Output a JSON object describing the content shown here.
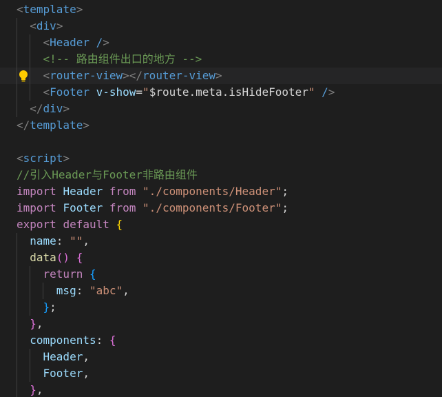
{
  "editor": {
    "lines": [
      [
        {
          "t": "<",
          "c": "punc"
        },
        {
          "t": "template",
          "c": "tag"
        },
        {
          "t": ">",
          "c": "punc"
        }
      ],
      [
        {
          "t": "  "
        },
        {
          "t": "<",
          "c": "punc"
        },
        {
          "t": "div",
          "c": "tag"
        },
        {
          "t": ">",
          "c": "punc"
        }
      ],
      [
        {
          "t": "    "
        },
        {
          "t": "<",
          "c": "punc"
        },
        {
          "t": "Header",
          "c": "tag"
        },
        {
          "t": " /",
          "c": "tag"
        },
        {
          "t": ">",
          "c": "punc"
        }
      ],
      [
        {
          "t": "    "
        },
        {
          "t": "<!-- 路由组件出口的地方 -->",
          "c": "comment"
        }
      ],
      [
        {
          "t": "    "
        },
        {
          "t": "<",
          "c": "punc"
        },
        {
          "t": "router-view",
          "c": "tag"
        },
        {
          "t": "></",
          "c": "punc"
        },
        {
          "t": "router-view",
          "c": "tag"
        },
        {
          "t": ">",
          "c": "punc"
        }
      ],
      [
        {
          "t": "    "
        },
        {
          "t": "<",
          "c": "punc"
        },
        {
          "t": "Footer",
          "c": "tag"
        },
        {
          "t": " "
        },
        {
          "t": "v-show",
          "c": "attr"
        },
        {
          "t": "=",
          "c": "plain"
        },
        {
          "t": "\"",
          "c": "str"
        },
        {
          "t": "$route.meta.isHideFooter",
          "c": "plain"
        },
        {
          "t": "\"",
          "c": "str"
        },
        {
          "t": " "
        },
        {
          "t": "/",
          "c": "tag"
        },
        {
          "t": ">",
          "c": "punc"
        }
      ],
      [
        {
          "t": "  "
        },
        {
          "t": "</",
          "c": "punc"
        },
        {
          "t": "div",
          "c": "tag"
        },
        {
          "t": ">",
          "c": "punc"
        }
      ],
      [
        {
          "t": "</",
          "c": "punc"
        },
        {
          "t": "template",
          "c": "tag"
        },
        {
          "t": ">",
          "c": "punc"
        }
      ],
      [],
      [
        {
          "t": "<",
          "c": "punc"
        },
        {
          "t": "script",
          "c": "tag"
        },
        {
          "t": ">",
          "c": "punc"
        }
      ],
      [
        {
          "t": "//引入Header与Footer非路由组件",
          "c": "comment"
        }
      ],
      [
        {
          "t": "import",
          "c": "kw"
        },
        {
          "t": " "
        },
        {
          "t": "Header",
          "c": "var"
        },
        {
          "t": " "
        },
        {
          "t": "from",
          "c": "kw"
        },
        {
          "t": " "
        },
        {
          "t": "\"./components/Header\"",
          "c": "str"
        },
        {
          "t": ";",
          "c": "plain"
        }
      ],
      [
        {
          "t": "import",
          "c": "kw"
        },
        {
          "t": " "
        },
        {
          "t": "Footer",
          "c": "var"
        },
        {
          "t": " "
        },
        {
          "t": "from",
          "c": "kw"
        },
        {
          "t": " "
        },
        {
          "t": "\"./components/Footer\"",
          "c": "str"
        },
        {
          "t": ";",
          "c": "plain"
        }
      ],
      [
        {
          "t": "export",
          "c": "kw"
        },
        {
          "t": " "
        },
        {
          "t": "default",
          "c": "kw"
        },
        {
          "t": " "
        },
        {
          "t": "{",
          "c": "brace1"
        }
      ],
      [
        {
          "t": "  "
        },
        {
          "t": "name",
          "c": "var"
        },
        {
          "t": ": ",
          "c": "plain"
        },
        {
          "t": "\"\"",
          "c": "str"
        },
        {
          "t": ",",
          "c": "plain"
        }
      ],
      [
        {
          "t": "  "
        },
        {
          "t": "data",
          "c": "func"
        },
        {
          "t": "()",
          "c": "brace2"
        },
        {
          "t": " "
        },
        {
          "t": "{",
          "c": "brace2"
        }
      ],
      [
        {
          "t": "    "
        },
        {
          "t": "return",
          "c": "kw"
        },
        {
          "t": " "
        },
        {
          "t": "{",
          "c": "brace3"
        }
      ],
      [
        {
          "t": "      "
        },
        {
          "t": "msg",
          "c": "var"
        },
        {
          "t": ": ",
          "c": "plain"
        },
        {
          "t": "\"abc\"",
          "c": "str"
        },
        {
          "t": ",",
          "c": "plain"
        }
      ],
      [
        {
          "t": "    "
        },
        {
          "t": "}",
          "c": "brace3"
        },
        {
          "t": ";",
          "c": "plain"
        }
      ],
      [
        {
          "t": "  "
        },
        {
          "t": "}",
          "c": "brace2"
        },
        {
          "t": ",",
          "c": "plain"
        }
      ],
      [
        {
          "t": "  "
        },
        {
          "t": "components",
          "c": "var"
        },
        {
          "t": ": ",
          "c": "plain"
        },
        {
          "t": "{",
          "c": "brace2"
        }
      ],
      [
        {
          "t": "    "
        },
        {
          "t": "Header",
          "c": "var"
        },
        {
          "t": ",",
          "c": "plain"
        }
      ],
      [
        {
          "t": "    "
        },
        {
          "t": "Footer",
          "c": "var"
        },
        {
          "t": ",",
          "c": "plain"
        }
      ],
      [
        {
          "t": "  "
        },
        {
          "t": "}",
          "c": "brace2"
        },
        {
          "t": ",",
          "c": "plain"
        }
      ]
    ],
    "guides": [
      [],
      [
        1
      ],
      [
        1,
        2
      ],
      [
        1,
        2
      ],
      [
        1,
        2
      ],
      [
        1,
        2
      ],
      [
        1
      ],
      [],
      [],
      [],
      [],
      [],
      [],
      [],
      [
        1
      ],
      [
        1
      ],
      [
        1,
        2
      ],
      [
        1,
        2,
        3
      ],
      [
        1,
        2
      ],
      [
        1
      ],
      [
        1
      ],
      [
        1,
        2
      ],
      [
        1,
        2
      ],
      [
        1
      ]
    ],
    "highlight_line": 4,
    "lightbulb_line": 4,
    "lightbulb_icon": "lightbulb-icon",
    "colors": {
      "background": "#1e1e1e",
      "tag": "#569cd6",
      "punctuation": "#808080",
      "comment": "#6a9955",
      "string": "#ce9178",
      "keyword": "#c586c0",
      "variable": "#9cdcfe",
      "function": "#dcdcaa"
    }
  }
}
